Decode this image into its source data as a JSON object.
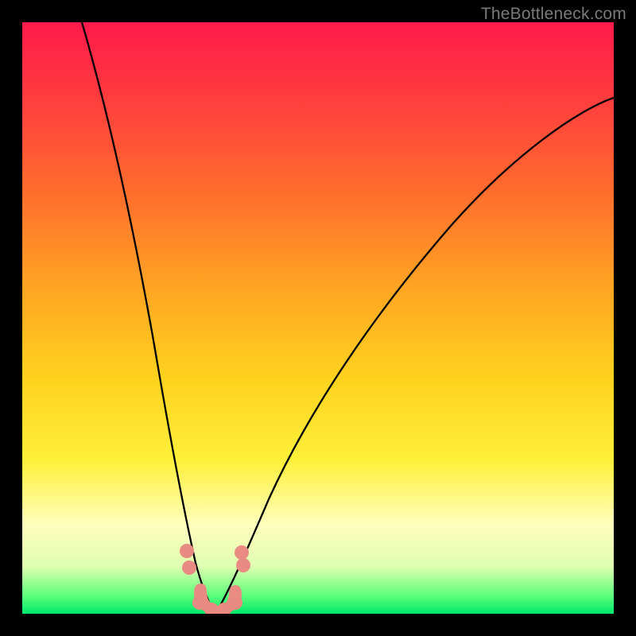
{
  "watermark": "TheBottleneck.com",
  "colors": {
    "frame": "#000000",
    "gradient_top": "#ff1a4b",
    "gradient_bottom": "#00e86a",
    "curve": "#000000",
    "marker": "#e98b83"
  },
  "chart_data": {
    "type": "line",
    "title": "",
    "xlabel": "",
    "ylabel": "",
    "xlim": [
      0,
      100
    ],
    "ylim": [
      0,
      100
    ],
    "grid": false,
    "legend": false,
    "note": "Axes are unlabeled in the image; x and y values below are estimated percentages of the plot area (0 = left/bottom, 100 = right/top). The two black curves descend into a V near x≈32 then the right curve rises toward the upper-right. Salmon dots cluster near the bottom of the V.",
    "series": [
      {
        "name": "left-curve",
        "x": [
          0,
          4,
          8,
          12,
          16,
          20,
          24,
          26,
          28,
          30,
          31,
          32
        ],
        "y": [
          100,
          88,
          76,
          64,
          52,
          40,
          26,
          18,
          11,
          5,
          2,
          0
        ]
      },
      {
        "name": "right-curve",
        "x": [
          32,
          34,
          36,
          40,
          46,
          54,
          62,
          72,
          84,
          96,
          100
        ],
        "y": [
          0,
          2,
          6,
          14,
          25,
          38,
          50,
          62,
          74,
          83,
          86
        ]
      }
    ],
    "markers": {
      "name": "bottom-cluster",
      "comment": "Salmon-colored dots clustered at the valley, ~y 0–10",
      "points": [
        {
          "x": 27.5,
          "y": 10
        },
        {
          "x": 27.8,
          "y": 7
        },
        {
          "x": 29,
          "y": 2
        },
        {
          "x": 30,
          "y": 1
        },
        {
          "x": 31,
          "y": 0.5
        },
        {
          "x": 32,
          "y": 0.5
        },
        {
          "x": 33,
          "y": 0.5
        },
        {
          "x": 34,
          "y": 0.7
        },
        {
          "x": 35.5,
          "y": 2
        },
        {
          "x": 37,
          "y": 9
        },
        {
          "x": 37.2,
          "y": 10
        }
      ]
    }
  }
}
